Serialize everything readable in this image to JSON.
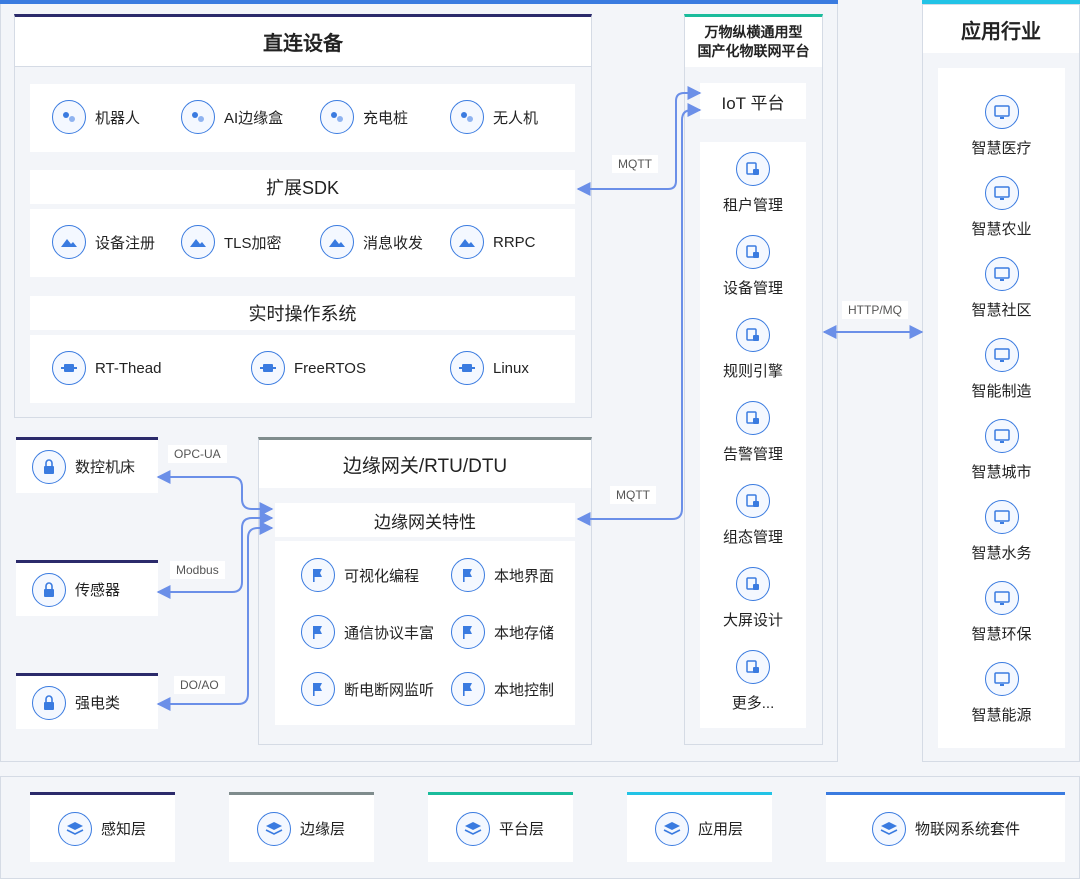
{
  "top_left": {
    "title": "直连设备",
    "devices": [
      "机器人",
      "AI边缘盒",
      "充电桩",
      "无人机"
    ],
    "sdk_title": "扩展SDK",
    "sdk_items": [
      "设备注册",
      "TLS加密",
      "消息收发",
      "RRPC"
    ],
    "os_title": "实时操作系统",
    "os_items": [
      "RT-Thead",
      "FreeRTOS",
      "Linux"
    ]
  },
  "edge": {
    "devices": [
      "数控机床",
      "传感器",
      "强电类"
    ],
    "protocols": [
      "OPC-UA",
      "Modbus",
      "DO/AO"
    ],
    "gateway_title": "边缘网关/RTU/DTU",
    "features_title": "边缘网关特性",
    "features": [
      "可视化编程",
      "本地界面",
      "通信协议丰富",
      "本地存储",
      "断电断网监听",
      "本地控制"
    ]
  },
  "platform": {
    "header_line1": "万物纵横通用型",
    "header_line2": "国产化物联网平台",
    "iot_title": "IoT 平台",
    "items": [
      "租户管理",
      "设备管理",
      "规则引擎",
      "告警管理",
      "组态管理",
      "大屏设计",
      "更多..."
    ]
  },
  "connectors": {
    "mqtt_top": "MQTT",
    "mqtt_bottom": "MQTT",
    "http": "HTTP/MQ"
  },
  "industry": {
    "title": "应用行业",
    "items": [
      "智慧医疗",
      "智慧农业",
      "智慧社区",
      "智能制造",
      "智慧城市",
      "智慧水务",
      "智慧环保",
      "智慧能源"
    ]
  },
  "legend": [
    {
      "label": "感知层",
      "color": "#2b2a6b"
    },
    {
      "label": "边缘层",
      "color": "#7f8c8d"
    },
    {
      "label": "平台层",
      "color": "#1abc9c"
    },
    {
      "label": "应用层",
      "color": "#22c3e6"
    },
    {
      "label": "物联网系统套件",
      "color": "#3a7be0"
    }
  ],
  "colors": {
    "accent": "#3a7be0",
    "line": "#6b8fe8"
  }
}
